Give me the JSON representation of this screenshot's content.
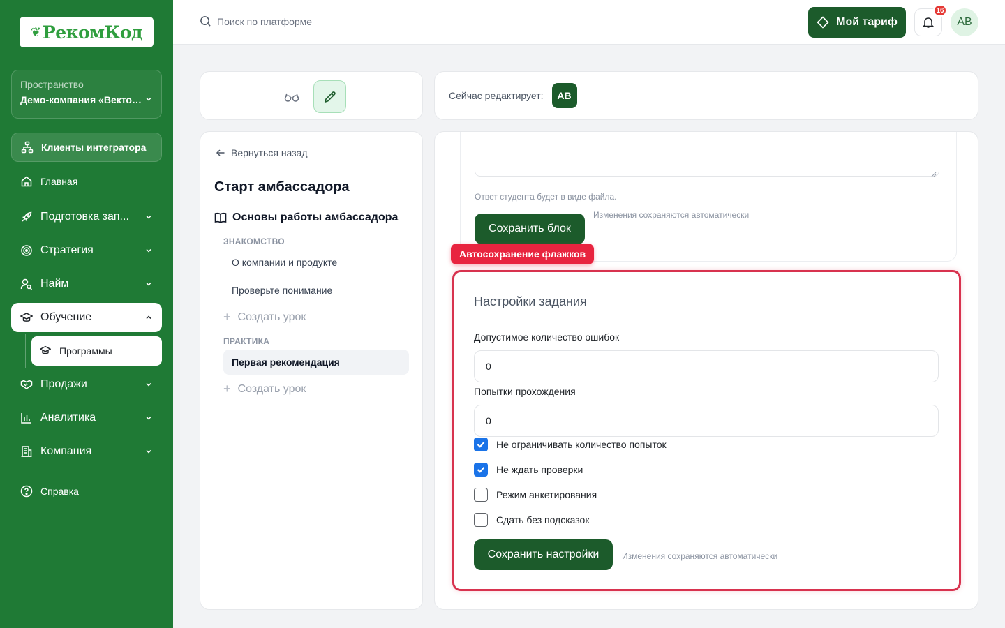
{
  "sidebar": {
    "logo": "РекомКод",
    "space": {
      "label": "Пространство",
      "value": "Демо-компания «Векто…"
    },
    "clients": "Клиенты интегратора",
    "items": [
      {
        "label": "Главная"
      },
      {
        "label": "Подготовка зап..."
      },
      {
        "label": "Стратегия"
      },
      {
        "label": "Найм"
      },
      {
        "label": "Обучение"
      },
      {
        "label": "Продажи"
      },
      {
        "label": "Аналитика"
      },
      {
        "label": "Компания"
      },
      {
        "label": "Справка"
      }
    ],
    "sub_item": "Программы"
  },
  "topbar": {
    "search_placeholder": "Поиск по платформе",
    "tariff": "Мой тариф",
    "notifications": "16",
    "avatar": "AB"
  },
  "editor": {
    "label": "Сейчас редактирует:",
    "avatar": "AB"
  },
  "course": {
    "back": "Вернуться назад",
    "title": "Старт амбассадора",
    "module": "Основы работы амбассадора",
    "sections": [
      {
        "label": "ЗНАКОМСТВО",
        "lessons": [
          "О компании и продукте",
          "Проверьте понимание"
        ],
        "create": "Создать урок"
      },
      {
        "label": "ПРАКТИКА",
        "lessons": [
          "Первая рекомендация"
        ],
        "create": "Создать урок"
      }
    ]
  },
  "block": {
    "hint": "Ответ студента будет в виде файла.",
    "save": "Сохранить блок",
    "autosave": "Изменения сохраняются автоматически"
  },
  "badge": "Автосохранение флажков",
  "settings": {
    "title": "Настройки задания",
    "errors_label": "Допустимое количество ошибок",
    "errors_value": "0",
    "attempts_label": "Попытки прохождения",
    "attempts_value": "0",
    "checkboxes": [
      {
        "label": "Не ограничивать количество попыток",
        "checked": true
      },
      {
        "label": "Не ждать проверки",
        "checked": true
      },
      {
        "label": "Режим анкетирования",
        "checked": false
      },
      {
        "label": "Сдать без подсказок",
        "checked": false
      }
    ],
    "save": "Сохранить настройки",
    "autosave": "Изменения сохраняются автоматически"
  },
  "colors": {
    "sidebar": "#1f7a35",
    "primary": "#1c5b2b",
    "alert": "#e8243f",
    "check": "#1a73e8"
  }
}
